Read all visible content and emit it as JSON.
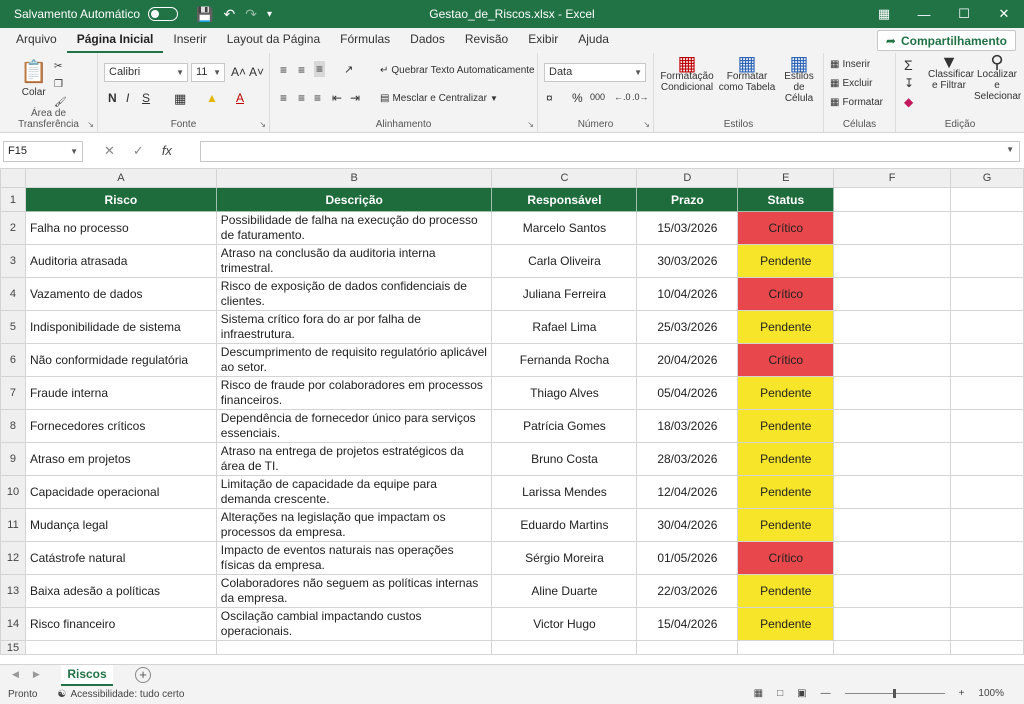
{
  "titlebar": {
    "autosave_label": "Salvamento Automático",
    "title": "Gestao_de_Riscos.xlsx  -  Excel"
  },
  "menu": {
    "tabs": [
      "Arquivo",
      "Página Inicial",
      "Inserir",
      "Layout da Página",
      "Fórmulas",
      "Dados",
      "Revisão",
      "Exibir",
      "Ajuda"
    ],
    "share_label": "Compartilhamento"
  },
  "ribbon": {
    "clipboard": {
      "paste": "Colar",
      "label": "Área de Transferência"
    },
    "font": {
      "name": "Calibri",
      "size": "11",
      "label": "Fonte"
    },
    "alignment": {
      "wrap": "Quebrar Texto Automaticamente",
      "merge": "Mesclar e Centralizar",
      "label": "Alinhamento"
    },
    "number": {
      "format": "Data",
      "label": "Número"
    },
    "styles": {
      "cond": "Formatação Condicional",
      "table": "Formatar como Tabela",
      "cell": "Estilos de Célula",
      "label": "Estilos"
    },
    "cells": {
      "insert": "Inserir",
      "delete": "Excluir",
      "format": "Formatar",
      "label": "Células"
    },
    "editing": {
      "sort": "Classificar e Filtrar",
      "find": "Localizar e Selecionar",
      "label": "Edição"
    }
  },
  "formula_bar": {
    "cell_ref": "F15",
    "value": ""
  },
  "columns": [
    "A",
    "B",
    "C",
    "D",
    "E",
    "F",
    "G"
  ],
  "header": {
    "risco": "Risco",
    "descricao": "Descrição",
    "responsavel": "Responsável",
    "prazo": "Prazo",
    "status": "Status"
  },
  "rows": [
    {
      "n": "2",
      "risco": "Falha no processo",
      "desc": "Possibilidade de falha na execução do processo de faturamento.",
      "resp": "Marcelo Santos",
      "prazo": "15/03/2026",
      "status": "Crítico"
    },
    {
      "n": "3",
      "risco": "Auditoria atrasada",
      "desc": "Atraso na conclusão da auditoria interna trimestral.",
      "resp": "Carla Oliveira",
      "prazo": "30/03/2026",
      "status": "Pendente"
    },
    {
      "n": "4",
      "risco": "Vazamento de dados",
      "desc": "Risco de exposição de dados confidenciais de clientes.",
      "resp": "Juliana Ferreira",
      "prazo": "10/04/2026",
      "status": "Crítico"
    },
    {
      "n": "5",
      "risco": "Indisponibilidade de sistema",
      "desc": "Sistema crítico fora do ar por falha de infraestrutura.",
      "resp": "Rafael Lima",
      "prazo": "25/03/2026",
      "status": "Pendente"
    },
    {
      "n": "6",
      "risco": "Não conformidade regulatória",
      "desc": "Descumprimento de requisito regulatório aplicável ao setor.",
      "resp": "Fernanda Rocha",
      "prazo": "20/04/2026",
      "status": "Crítico"
    },
    {
      "n": "7",
      "risco": "Fraude interna",
      "desc": "Risco de fraude por colaboradores em processos financeiros.",
      "resp": "Thiago Alves",
      "prazo": "05/04/2026",
      "status": "Pendente"
    },
    {
      "n": "8",
      "risco": "Fornecedores críticos",
      "desc": "Dependência de fornecedor único para serviços essenciais.",
      "resp": "Patrícia Gomes",
      "prazo": "18/03/2026",
      "status": "Pendente"
    },
    {
      "n": "9",
      "risco": "Atraso em projetos",
      "desc": "Atraso na entrega de projetos estratégicos da área de TI.",
      "resp": "Bruno Costa",
      "prazo": "28/03/2026",
      "status": "Pendente"
    },
    {
      "n": "10",
      "risco": "Capacidade operacional",
      "desc": "Limitação de capacidade da equipe para demanda crescente.",
      "resp": "Larissa Mendes",
      "prazo": "12/04/2026",
      "status": "Pendente"
    },
    {
      "n": "11",
      "risco": "Mudança legal",
      "desc": "Alterações na legislação que impactam os processos da empresa.",
      "resp": "Eduardo Martins",
      "prazo": "30/04/2026",
      "status": "Pendente"
    },
    {
      "n": "12",
      "risco": "Catástrofe natural",
      "desc": "Impacto de eventos naturais nas operações físicas da empresa.",
      "resp": "Sérgio Moreira",
      "prazo": "01/05/2026",
      "status": "Crítico"
    },
    {
      "n": "13",
      "risco": "Baixa adesão a políticas",
      "desc": "Colaboradores não seguem as políticas internas da empresa.",
      "resp": "Aline Duarte",
      "prazo": "22/03/2026",
      "status": "Pendente"
    },
    {
      "n": "14",
      "risco": "Risco financeiro",
      "desc": "Oscilação cambial impactando custos operacionais.",
      "resp": "Victor Hugo",
      "prazo": "15/04/2026",
      "status": "Pendente"
    }
  ],
  "status_colors": {
    "Crítico": "#e8474c",
    "Pendente": "#f7e52a"
  },
  "sheet_tab": "Riscos",
  "statusbar": {
    "ready": "Pronto",
    "accessibility": "Acessibilidade: tudo certo",
    "zoom": "100%"
  }
}
